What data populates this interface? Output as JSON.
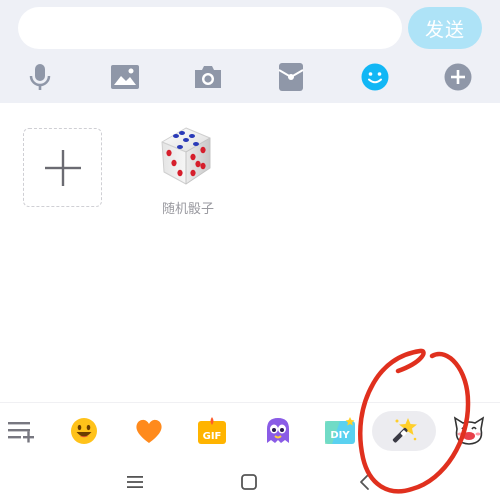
{
  "composer": {
    "input_placeholder": "",
    "send_label": "发送"
  },
  "toolbar": {
    "icons": [
      "microphone-icon",
      "image-icon",
      "camera-icon",
      "red-packet-icon",
      "emoji-icon",
      "plus-icon"
    ],
    "active_icon": "emoji-icon",
    "active_color": "#12b7f5",
    "inactive_color": "#8f97a8"
  },
  "sticker_panel": {
    "items": [
      {
        "name": "add-sticker",
        "label": ""
      },
      {
        "name": "random-dice",
        "label": "随机骰子"
      }
    ]
  },
  "emoji_tabs": {
    "icons": [
      "list-add-icon",
      "smiley-face-icon",
      "heart-icon",
      "gif-icon",
      "purple-monster-icon",
      "diy-icon",
      "magic-wand-icon",
      "cartoon-cat-icon"
    ],
    "selected": "magic-wand-icon",
    "gif_label": "GIF",
    "diy_label": "DIY"
  },
  "system_nav": {
    "icons": [
      "menu-icon",
      "home-square-icon",
      "back-chevron-icon"
    ]
  },
  "annotation": {
    "type": "hand-drawn red circle",
    "color": "#e0301e",
    "target": "magic-wand-icon"
  }
}
